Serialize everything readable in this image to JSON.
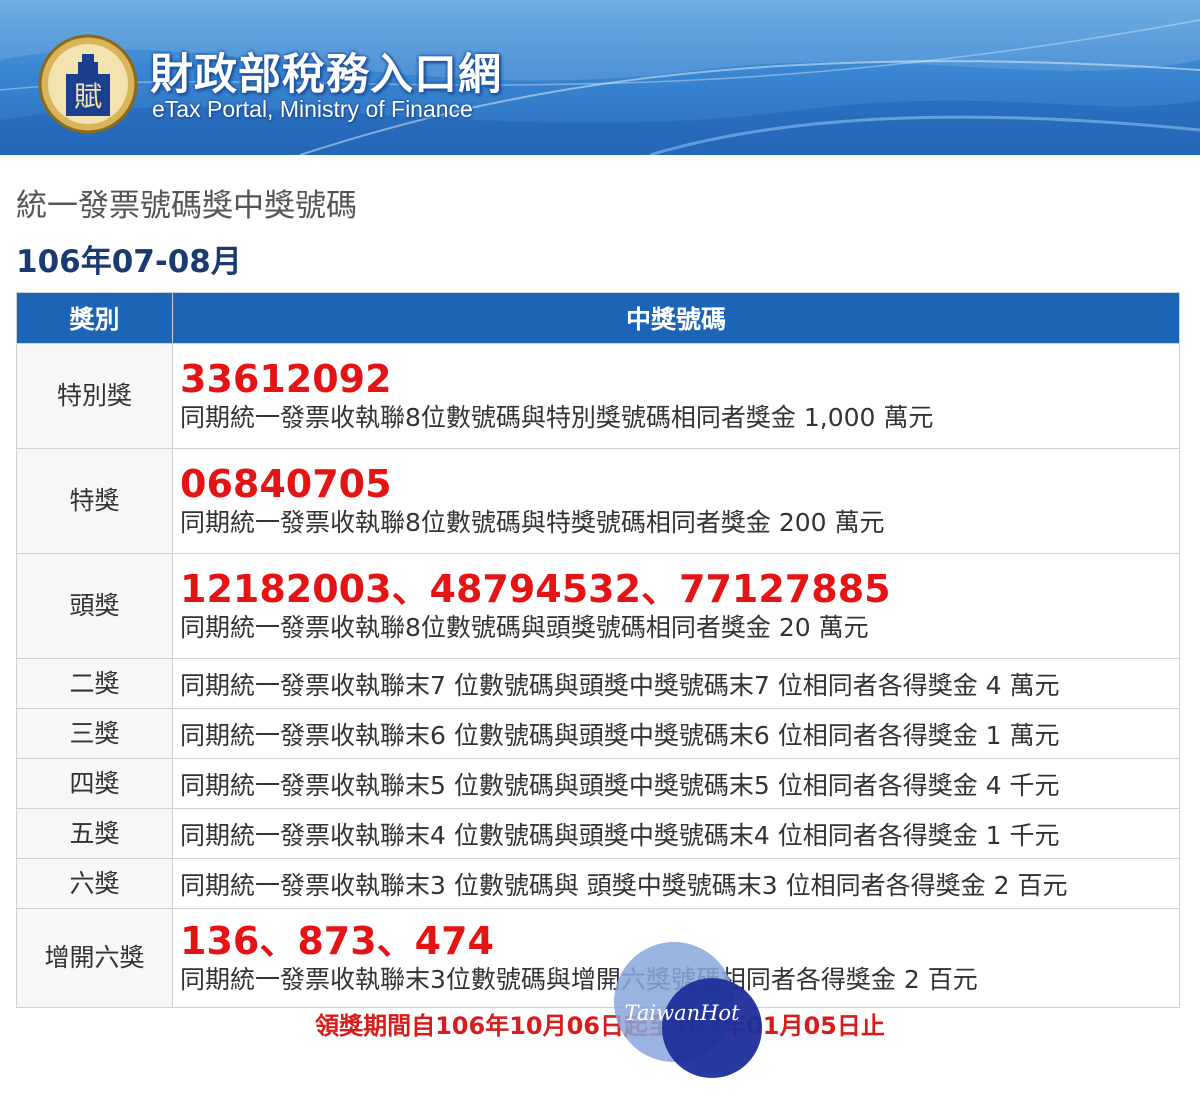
{
  "header": {
    "site_title": "財政部稅務入口網",
    "site_subtitle": "eTax Portal, Ministry of Finance",
    "logo_text": "賦"
  },
  "page": {
    "title": "統一發票號碼獎中獎號碼",
    "period": "106年07-08月"
  },
  "table": {
    "headers": [
      "獎別",
      "中獎號碼"
    ],
    "rows": [
      {
        "category": "特別獎",
        "numbers": "33612092",
        "description": "同期統一發票收執聯8位數號碼與特別獎號碼相同者獎金 1,000 萬元"
      },
      {
        "category": "特獎",
        "numbers": "06840705",
        "description": "同期統一發票收執聯8位數號碼與特獎號碼相同者獎金 200 萬元"
      },
      {
        "category": "頭獎",
        "numbers": "12182003、48794532、77127885",
        "description": "同期統一發票收執聯8位數號碼與頭獎號碼相同者獎金 20 萬元"
      },
      {
        "category": "二獎",
        "description": "同期統一發票收執聯末7 位數號碼與頭獎中獎號碼末7 位相同者各得獎金 4 萬元"
      },
      {
        "category": "三獎",
        "description": "同期統一發票收執聯末6 位數號碼與頭獎中獎號碼末6 位相同者各得獎金 1 萬元"
      },
      {
        "category": "四獎",
        "description": "同期統一發票收執聯末5 位數號碼與頭獎中獎號碼末5 位相同者各得獎金 4 千元"
      },
      {
        "category": "五獎",
        "description": "同期統一發票收執聯末4 位數號碼與頭獎中獎號碼末4 位相同者各得獎金 1 千元"
      },
      {
        "category": "六獎",
        "description": "同期統一發票收執聯末3 位數號碼與 頭獎中獎號碼末3 位相同者各得獎金 2 百元"
      },
      {
        "category": "增開六獎",
        "numbers": "136、873、474",
        "description": "同期統一發票收執聯末3位數號碼與增開六獎號碼相同者各得獎金 2 百元"
      }
    ]
  },
  "footer": {
    "claim_period": "領獎期間自106年10月06日起至107年01月05日止"
  },
  "watermark": {
    "text": "TaiwanHot"
  },
  "colors": {
    "banner": "#3a86d2",
    "header_row": "#1b64b6",
    "numbers": "#e41414",
    "claim": "#d81c1c"
  }
}
